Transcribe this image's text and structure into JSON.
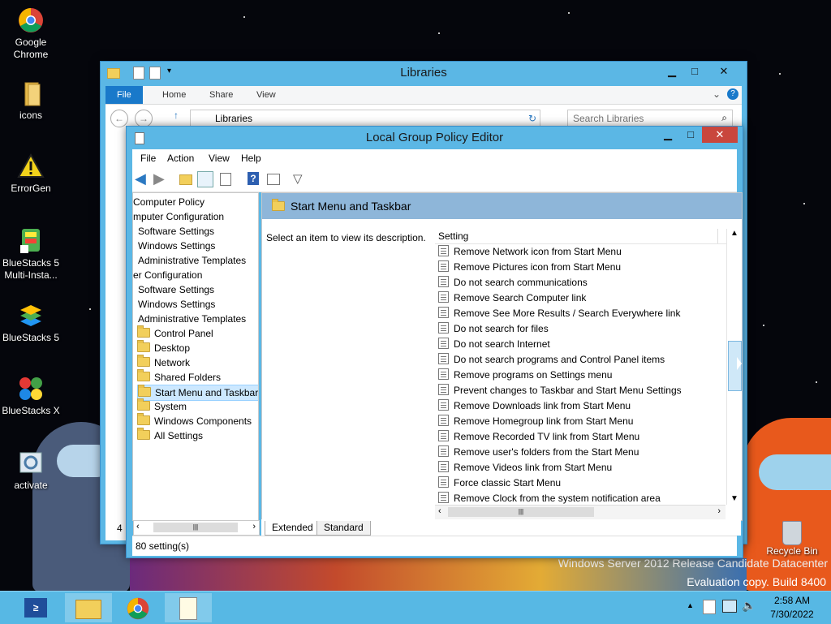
{
  "desktop": {
    "icons": [
      {
        "label": "Google Chrome",
        "icon": "chrome-icon"
      },
      {
        "label": "icons",
        "icon": "folder-icon"
      },
      {
        "label": "ErrorGen",
        "icon": "warning-icon"
      },
      {
        "label": "BlueStacks 5 Multi-Insta...",
        "icon": "bluestacks-multi-icon"
      },
      {
        "label": "BlueStacks 5",
        "icon": "bluestacks-icon"
      },
      {
        "label": "BlueStacks X",
        "icon": "bluestacks-x-icon"
      },
      {
        "label": "activate",
        "icon": "activate-icon"
      }
    ],
    "recycle_bin": "Recycle Bin",
    "watermark_line1": "Windows Server 2012 Release Candidate Datacenter",
    "watermark_line2": "Evaluation copy. Build 8400"
  },
  "libraries": {
    "title": "Libraries",
    "tabs": [
      "File",
      "Home",
      "Share",
      "View"
    ],
    "address": "Libraries",
    "search_placeholder": "Search Libraries",
    "status_count": "4"
  },
  "gpedit": {
    "title": "Local Group Policy Editor",
    "menu": [
      "File",
      "Action",
      "View",
      "Help"
    ],
    "tree": [
      {
        "label": "Computer Policy",
        "indent": 0,
        "folder": false,
        "selected": false
      },
      {
        "label": "mputer Configuration",
        "indent": 0,
        "folder": false,
        "selected": false
      },
      {
        "label": "Software Settings",
        "indent": 1,
        "folder": false,
        "selected": false
      },
      {
        "label": "Windows Settings",
        "indent": 1,
        "folder": false,
        "selected": false
      },
      {
        "label": "Administrative Templates",
        "indent": 1,
        "folder": false,
        "selected": false
      },
      {
        "label": "er Configuration",
        "indent": 0,
        "folder": false,
        "selected": false
      },
      {
        "label": "Software Settings",
        "indent": 1,
        "folder": false,
        "selected": false
      },
      {
        "label": "Windows Settings",
        "indent": 1,
        "folder": false,
        "selected": false
      },
      {
        "label": "Administrative Templates",
        "indent": 1,
        "folder": false,
        "selected": false
      },
      {
        "label": "Control Panel",
        "indent": 2,
        "folder": true,
        "selected": false
      },
      {
        "label": "Desktop",
        "indent": 2,
        "folder": true,
        "selected": false
      },
      {
        "label": "Network",
        "indent": 2,
        "folder": true,
        "selected": false
      },
      {
        "label": "Shared Folders",
        "indent": 2,
        "folder": true,
        "selected": false
      },
      {
        "label": "Start Menu and Taskbar",
        "indent": 2,
        "folder": true,
        "selected": true
      },
      {
        "label": "System",
        "indent": 2,
        "folder": true,
        "selected": false
      },
      {
        "label": "Windows Components",
        "indent": 2,
        "folder": true,
        "selected": false
      },
      {
        "label": "All Settings",
        "indent": 2,
        "folder": true,
        "selected": false
      }
    ],
    "section_title": "Start Menu and Taskbar",
    "description": "Select an item to view its description.",
    "column_header": "Setting",
    "settings": [
      "Remove Network icon from Start Menu",
      "Remove Pictures icon from Start Menu",
      "Do not search communications",
      "Remove Search Computer link",
      "Remove See More Results / Search Everywhere link",
      "Do not search for files",
      "Do not search Internet",
      "Do not search programs and Control Panel items",
      "Remove programs on Settings menu",
      "Prevent changes to Taskbar and Start Menu Settings",
      "Remove Downloads link from Start Menu",
      "Remove Homegroup link from Start Menu",
      "Remove Recorded TV link from Start Menu",
      "Remove user's folders from the Start Menu",
      "Remove Videos link from Start Menu",
      "Force classic Start Menu",
      "Remove Clock from the system notification area"
    ],
    "view_tabs": [
      "Extended",
      "Standard"
    ],
    "status": "80 setting(s)"
  },
  "taskbar": {
    "time": "2:58 AM",
    "date": "7/30/2022"
  },
  "colors": {
    "window_frame": "#5bb7e5",
    "taskbar": "#57b8e4",
    "selection": "#cce8ff",
    "close_button": "#c9463d"
  }
}
